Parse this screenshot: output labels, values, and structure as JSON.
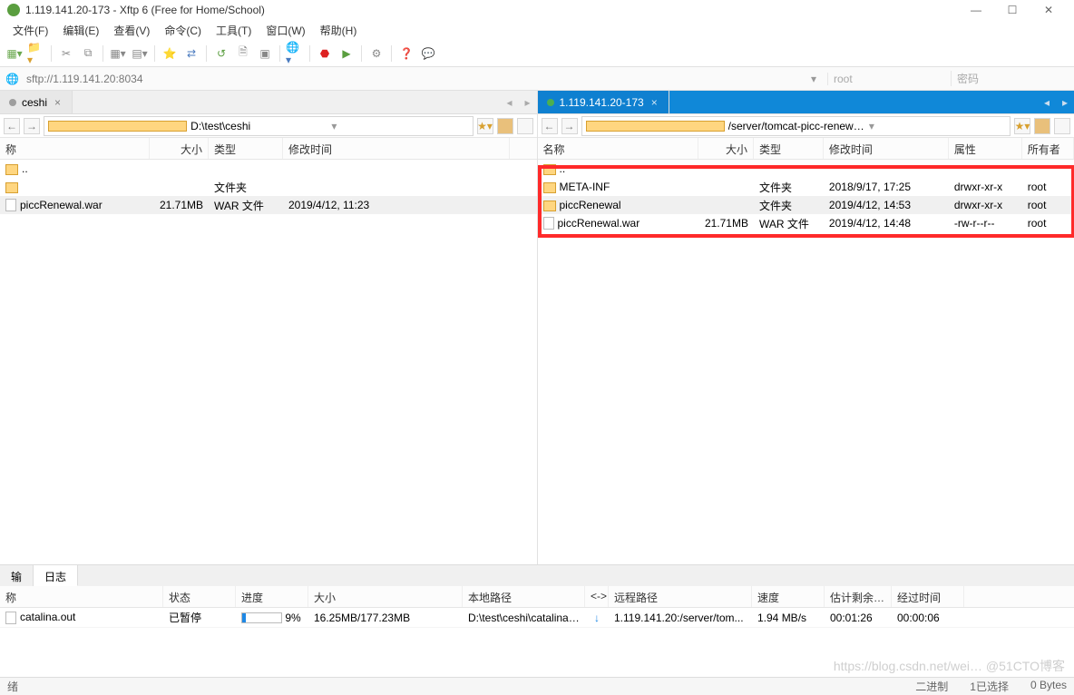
{
  "window": {
    "title": "1.119.141.20-173 - Xftp 6 (Free for Home/School)"
  },
  "menu": {
    "file": "文件(F)",
    "edit": "编辑(E)",
    "view": "查看(V)",
    "cmd": "命令(C)",
    "tools": "工具(T)",
    "window": "窗口(W)",
    "help": "帮助(H)"
  },
  "address": {
    "proto": "sftp://1.119.141.20:8034",
    "user": "root",
    "pass": "密码"
  },
  "local": {
    "tab": "ceshi",
    "path": "D:\\test\\ceshi",
    "cols": {
      "name": "称",
      "size": "大小",
      "type": "类型",
      "mod": "修改时间"
    },
    "rows": [
      {
        "kind": "up",
        "name": ".."
      },
      {
        "kind": "folder",
        "name": "",
        "type": "文件夹"
      },
      {
        "kind": "file",
        "name": "piccRenewal.war",
        "size": "21.71MB",
        "type": "WAR 文件",
        "mod": "2019/4/12, 11:23",
        "sel": true
      }
    ]
  },
  "remote": {
    "tab": "1.119.141.20-173",
    "path": "/server/tomcat-picc-renewal/webapps",
    "cols": {
      "name": "名称",
      "size": "大小",
      "type": "类型",
      "mod": "修改时间",
      "perm": "属性",
      "own": "所有者"
    },
    "rows": [
      {
        "kind": "up",
        "name": ".."
      },
      {
        "kind": "folder",
        "name": "META-INF",
        "type": "文件夹",
        "mod": "2018/9/17, 17:25",
        "perm": "drwxr-xr-x",
        "own": "root"
      },
      {
        "kind": "folder",
        "name": "piccRenewal",
        "type": "文件夹",
        "mod": "2019/4/12, 14:53",
        "perm": "drwxr-xr-x",
        "own": "root",
        "sel": true
      },
      {
        "kind": "file",
        "name": "piccRenewal.war",
        "size": "21.71MB",
        "type": "WAR 文件",
        "mod": "2019/4/12, 14:48",
        "perm": "-rw-r--r--",
        "own": "root"
      }
    ]
  },
  "bottomTabs": {
    "tab1": "输",
    "tab2": "日志"
  },
  "transfer": {
    "cols": {
      "name": "称",
      "status": "状态",
      "progress": "进度",
      "size": "大小",
      "local": "本地路径",
      "arrow": "<->",
      "remote": "远程路径",
      "speed": "速度",
      "eta": "估计剩余…",
      "elapsed": "经过时间"
    },
    "rows": [
      {
        "name": "catalina.out",
        "status": "已暂停",
        "progress": 9,
        "size": "16.25MB/177.23MB",
        "local": "D:\\test\\ceshi\\catalina....",
        "arrow": "↓",
        "remote": "1.119.141.20:/server/tom...",
        "speed": "1.94 MB/s",
        "eta": "00:01:26",
        "elapsed": "00:00:06"
      }
    ]
  },
  "status": {
    "left": "绪",
    "binary": "二进制",
    "sel": "1已选择",
    "bytes": "0 Bytes"
  },
  "watermark": "https://blog.csdn.net/wei… @51CTO博客"
}
